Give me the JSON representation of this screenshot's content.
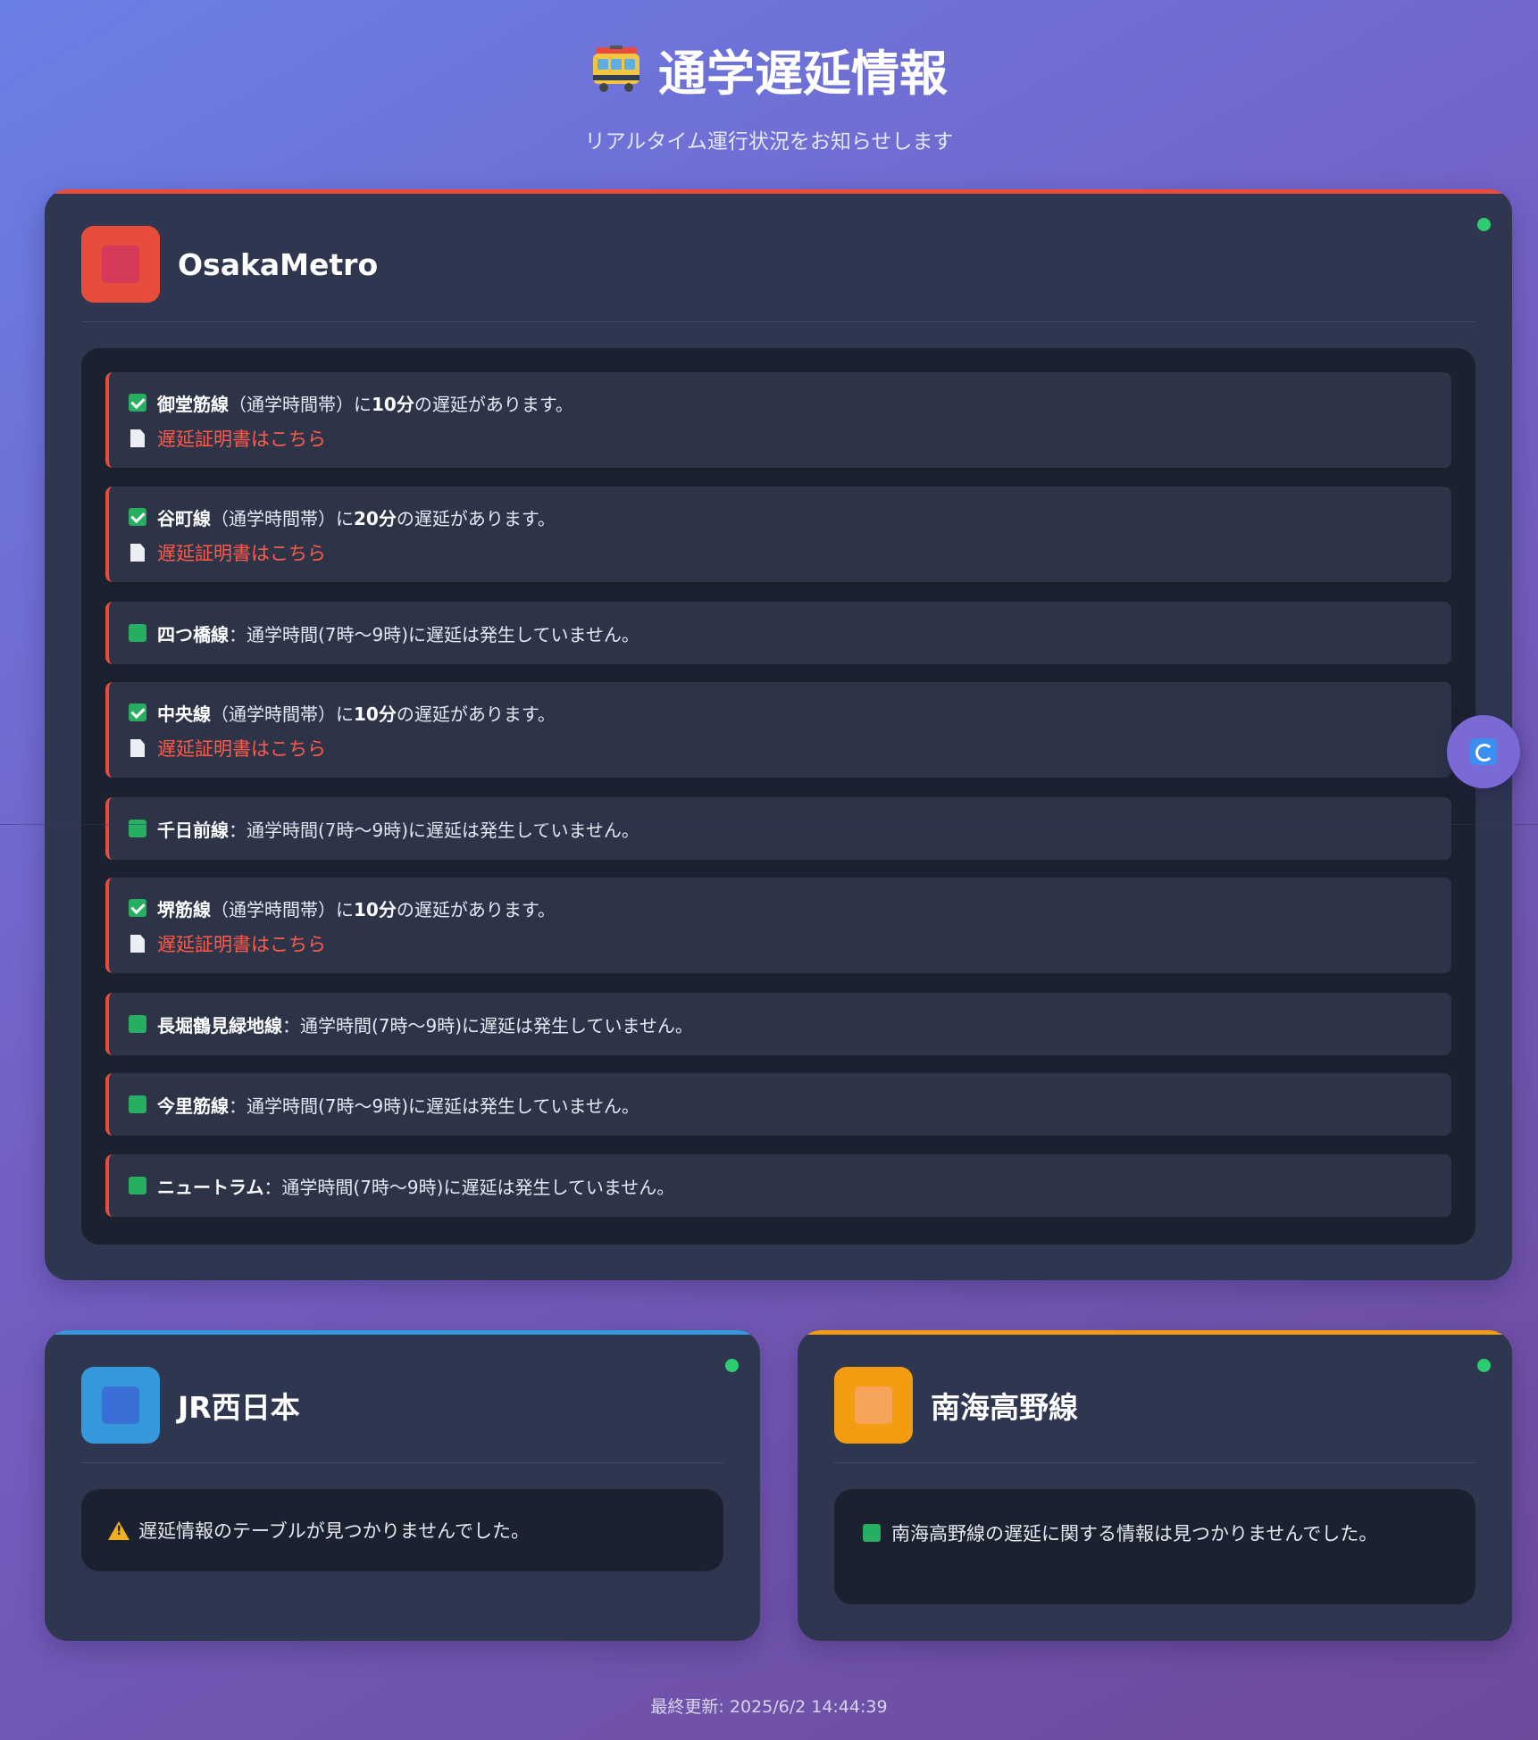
{
  "page": {
    "title": "通学遅延情報",
    "subtitle": "リアルタイム運行状況をお知らせします",
    "footer_label": "最終更新:",
    "footer_time": "2025/6/2 14:44:39"
  },
  "colors": {
    "osaka_metro": "#e74c3c",
    "jr_west": "#3498db",
    "nankai": "#f39c12",
    "status_ok": "#2ecc71",
    "link": "#ff5a4a"
  },
  "icons": {
    "title": "train-icon",
    "refresh": "refresh-icon",
    "delay": "check-icon",
    "no_delay": "green-square-icon",
    "certificate": "document-icon",
    "warning": "warning-icon",
    "status": "status-dot"
  },
  "osaka_metro": {
    "name": "OsakaMetro",
    "lines": [
      {
        "name": "御堂筋線",
        "text_pre": "（通学時間帯）に",
        "minutes": "10分",
        "text_post": "の遅延があります。",
        "delayed": true,
        "cert_link": "遅延証明書はこちら"
      },
      {
        "name": "谷町線",
        "text_pre": "（通学時間帯）に",
        "minutes": "20分",
        "text_post": "の遅延があります。",
        "delayed": true,
        "cert_link": "遅延証明書はこちら"
      },
      {
        "name": "四つ橋線",
        "status": "：通学時間(7時〜9時)に遅延は発生していません。",
        "delayed": false
      },
      {
        "name": "中央線",
        "text_pre": "（通学時間帯）に",
        "minutes": "10分",
        "text_post": "の遅延があります。",
        "delayed": true,
        "cert_link": "遅延証明書はこちら"
      },
      {
        "name": "千日前線",
        "status": "：通学時間(7時〜9時)に遅延は発生していません。",
        "delayed": false
      },
      {
        "name": "堺筋線",
        "text_pre": "（通学時間帯）に",
        "minutes": "10分",
        "text_post": "の遅延があります。",
        "delayed": true,
        "cert_link": "遅延証明書はこちら"
      },
      {
        "name": "長堀鶴見緑地線",
        "status": "：通学時間(7時〜9時)に遅延は発生していません。",
        "delayed": false
      },
      {
        "name": "今里筋線",
        "status": "：通学時間(7時〜9時)に遅延は発生していません。",
        "delayed": false
      },
      {
        "name": "ニュートラム",
        "status": "：通学時間(7時〜9時)に遅延は発生していません。",
        "delayed": false
      }
    ]
  },
  "jr_west": {
    "name": "JR西日本",
    "message": "遅延情報のテーブルが見つかりませんでした。"
  },
  "nankai": {
    "name": "南海高野線",
    "message": "南海高野線の遅延に関する情報は見つかりませんでした。"
  }
}
